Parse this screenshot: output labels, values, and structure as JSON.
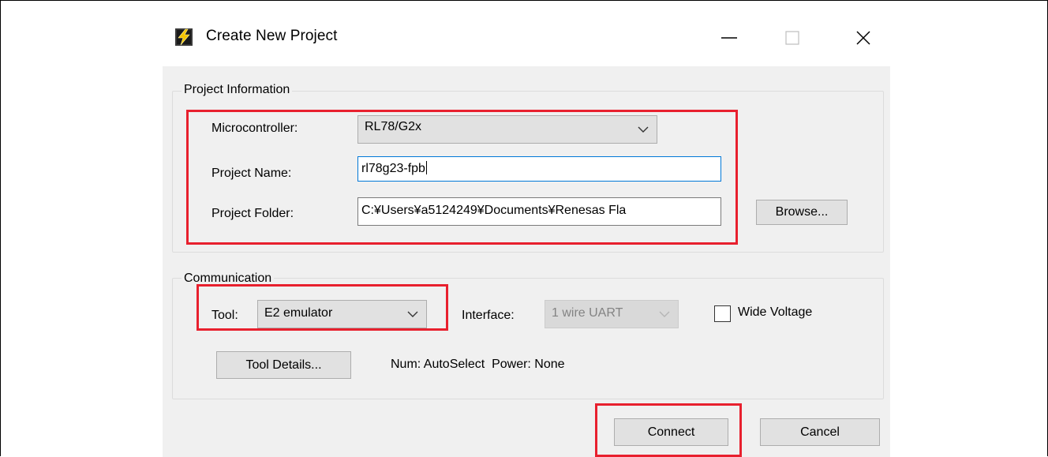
{
  "window": {
    "title": "Create New Project"
  },
  "project_information": {
    "group_label": "Project Information",
    "microcontroller": {
      "label": "Microcontroller:",
      "value": "RL78/G2x"
    },
    "project_name": {
      "label": "Project Name:",
      "value": "rl78g23-fpb"
    },
    "project_folder": {
      "label": "Project Folder:",
      "value": "C:¥Users¥a5124249¥Documents¥Renesas Fla"
    },
    "browse_label": "Browse..."
  },
  "communication": {
    "group_label": "Communication",
    "tool": {
      "label": "Tool:",
      "value": "E2 emulator"
    },
    "interface": {
      "label": "Interface:",
      "value": "1 wire UART"
    },
    "wide_voltage": {
      "label": "Wide Voltage",
      "checked": false
    },
    "tool_details_label": "Tool Details...",
    "status_text": "Num: AutoSelect  Power: None"
  },
  "footer": {
    "connect_label": "Connect",
    "cancel_label": "Cancel"
  },
  "colors": {
    "highlight": "#e8202e",
    "focus_border": "#0078d7"
  }
}
